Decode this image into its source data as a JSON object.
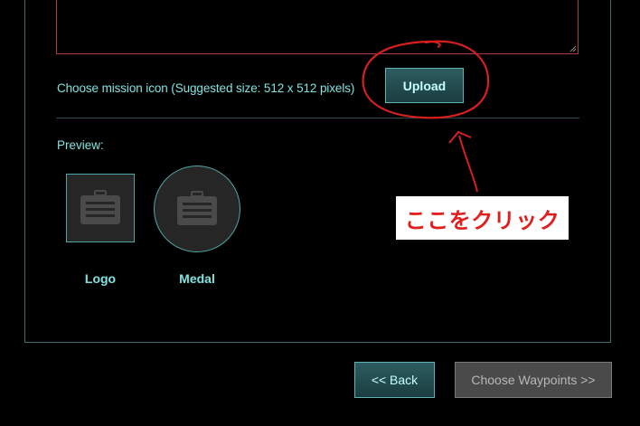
{
  "form": {
    "description_value": "",
    "icon_label": "Choose mission icon (Suggested size: 512 x 512 pixels)",
    "upload_label": "Upload",
    "preview_label": "Preview:",
    "logo_caption": "Logo",
    "medal_caption": "Medal"
  },
  "annotation": {
    "text": "ここをクリック",
    "color": "#e01e1e"
  },
  "footer": {
    "back_label": "<< Back",
    "next_label": "Choose Waypoints >>"
  },
  "icons": {
    "preview_placeholder": "briefcase-icon",
    "resize": "resize-grip-icon"
  },
  "colors": {
    "accent": "#7fe3e0",
    "button_bg": "#2d5c60",
    "disabled_bg": "#4a4a4a",
    "annotation_red": "#e01e1e"
  }
}
